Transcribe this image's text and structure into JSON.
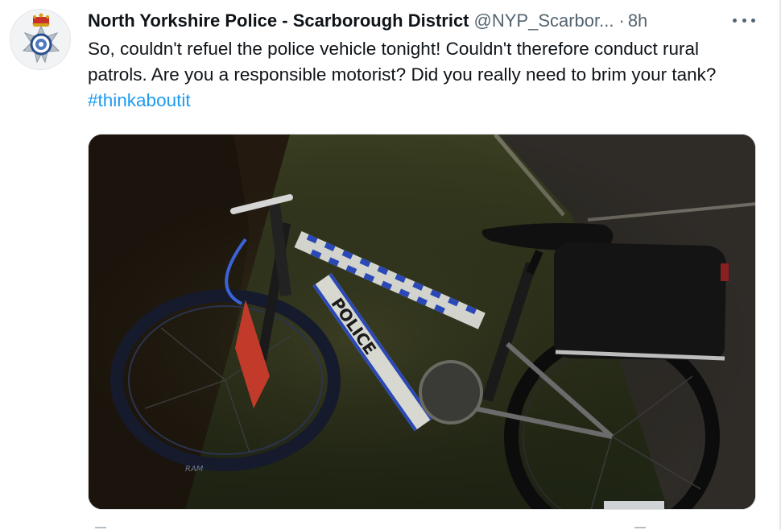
{
  "tweet": {
    "display_name": "North Yorkshire Police - Scarborough District",
    "handle": "@NYP_Scarbor...",
    "separator": "·",
    "time": "8h",
    "text_main": "So, couldn't refuel the police vehicle tonight! Couldn't therefore conduct rural patrols. Are you a responsible motorist? Did you really need to brim your tank? ",
    "hashtag": "#thinkaboutit",
    "more_icon": "more-horizontal-icon",
    "avatar_icon": "police-crest-icon"
  },
  "media": {
    "bike_frame_text": "POLICE",
    "tyre_text": "RAM"
  },
  "colors": {
    "text": "#0f1419",
    "secondary": "#536471",
    "link": "#1d9bf0"
  }
}
